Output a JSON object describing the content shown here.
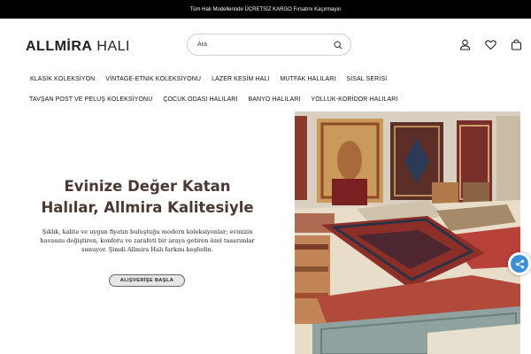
{
  "announcement": "Tüm Halı Modellerinde ÜCRETSİZ KARGO Fırsatını Kaçırmayın",
  "logo": {
    "part1": "ALLMİRA",
    "part2": " HALI"
  },
  "search": {
    "placeholder": "Ara"
  },
  "header_icons": [
    "user-icon",
    "heart-icon",
    "bag-icon"
  ],
  "nav": {
    "row1": [
      "KLASİK KOLEKSİYON",
      "VİNTAGE-ETNİK KOLEKSİYONU",
      "LAZER KESİM HALI",
      "MUTFAK HALILARI",
      "SİSAL SERİSİ"
    ],
    "row2": [
      "TAVŞAN POST VE PELUŞ KOLEKSİYONU",
      "ÇOCUK ODASI HALILARI",
      "BANYO HALILARI",
      "YOLLUK-KORİDOR HALILARI"
    ]
  },
  "hero": {
    "title_line1": "Evinize Değer Katan",
    "title_line2": "Halılar, Allmira Kalitesiyle",
    "description": "Şıklık, kalite ve uygun fiyatın buluştuğu modern koleksiyonlar; evinizin havasını değiştiren, konforu ve zarafeti bir araya getiren özel tasarımlar sunuyor. Şimdi Allmira Halı farkını keşfedin.",
    "cta": "ALIŞVERİŞE BAŞLA"
  },
  "colors": {
    "topbar": "#000000",
    "title": "#4a3a33",
    "share": "#3a8fd6"
  }
}
